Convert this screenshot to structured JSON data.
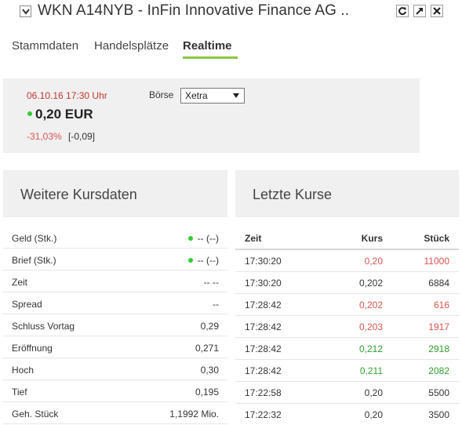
{
  "window": {
    "title": "WKN A14NYB - InFin Innovative Finance AG .."
  },
  "tabs": [
    {
      "label": "Stammdaten"
    },
    {
      "label": "Handelsplätze"
    },
    {
      "label": "Realtime",
      "active": true
    }
  ],
  "quote": {
    "datetime": "06.10.16  17:30 Uhr",
    "exchange_label": "Börse",
    "exchange_value": "Xetra",
    "price": "0,20 EUR",
    "change_pct": "-31,03%",
    "change_abs": "[-0,09]"
  },
  "kursdaten": {
    "title": "Weitere Kursdaten",
    "rows": [
      {
        "label": "Geld (Stk.)",
        "value": "-- (--)"
      },
      {
        "label": "Brief (Stk.)",
        "value": "-- (--)"
      },
      {
        "label": "Zeit",
        "value": "-- --"
      },
      {
        "label": "Spread",
        "value": "--"
      },
      {
        "label": "Schluss Vortag",
        "value": "0,29"
      },
      {
        "label": "Eröffnung",
        "value": "0,271"
      },
      {
        "label": "Hoch",
        "value": "0,30"
      },
      {
        "label": "Tief",
        "value": "0,195"
      },
      {
        "label": "Geh. Stück",
        "value": "1,1992 Mio."
      }
    ]
  },
  "letzte_kurse": {
    "title": "Letzte Kurse",
    "columns": {
      "zeit": "Zeit",
      "kurs": "Kurs",
      "stueck": "Stück"
    },
    "rows": [
      {
        "zeit": "17:30:20",
        "kurs": "0,20",
        "stueck": "11000",
        "color": "red"
      },
      {
        "zeit": "17:30:20",
        "kurs": "0,202",
        "stueck": "6884",
        "color": "dark"
      },
      {
        "zeit": "17:28:42",
        "kurs": "0,202",
        "stueck": "616",
        "color": "red"
      },
      {
        "zeit": "17:28:42",
        "kurs": "0,203",
        "stueck": "1917",
        "color": "red"
      },
      {
        "zeit": "17:28:42",
        "kurs": "0,212",
        "stueck": "2918",
        "color": "green"
      },
      {
        "zeit": "17:28:42",
        "kurs": "0,211",
        "stueck": "2082",
        "color": "green"
      },
      {
        "zeit": "17:22:58",
        "kurs": "0,20",
        "stueck": "5500",
        "color": "dark"
      },
      {
        "zeit": "17:22:32",
        "kurs": "0,20",
        "stueck": "3500",
        "color": "dark"
      }
    ]
  },
  "colors": {
    "accent_green": "#8cc63f",
    "negative_red": "#d9534f",
    "positive_green": "#2e9e2e",
    "live_dot": "#33cc33"
  },
  "icons": {
    "collapse": "chevron-down-icon",
    "refresh": "refresh-icon",
    "popout": "popout-arrow-icon",
    "close": "close-icon"
  }
}
